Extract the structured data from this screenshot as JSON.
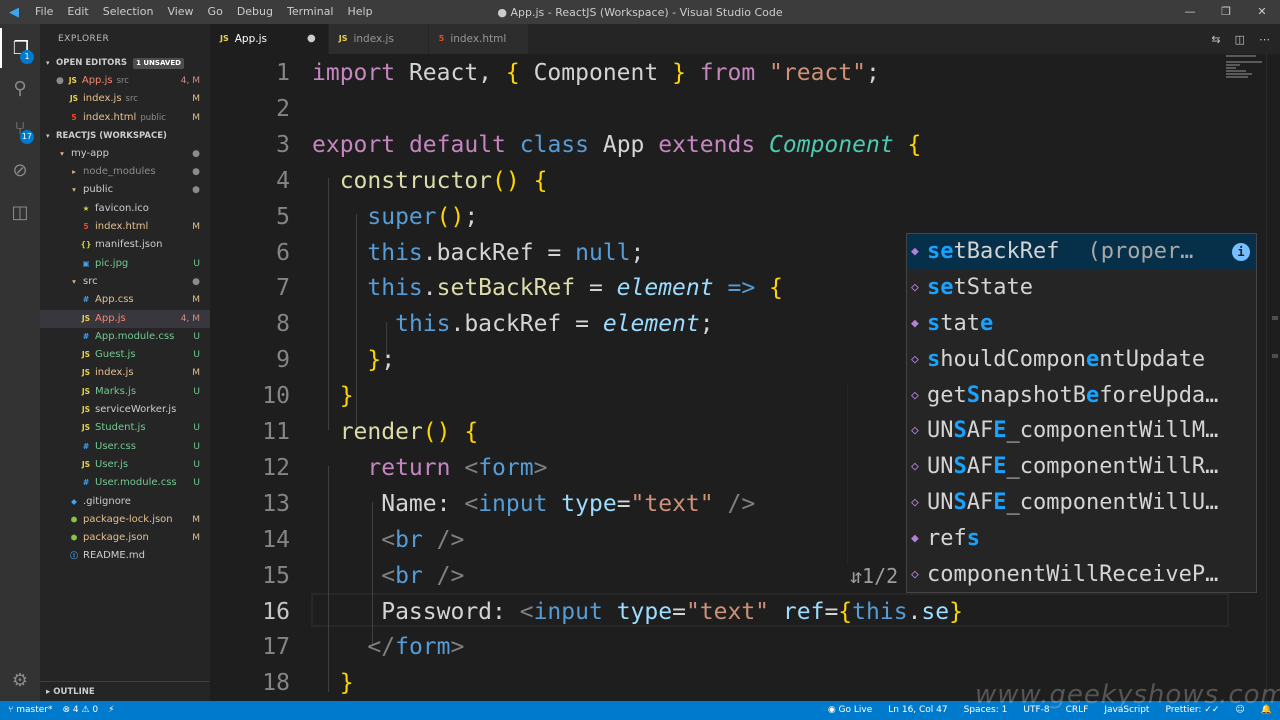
{
  "titlebar": {
    "menu": [
      "File",
      "Edit",
      "Selection",
      "View",
      "Go",
      "Debug",
      "Terminal",
      "Help"
    ],
    "title": "● App.js - ReactJS (Workspace) - Visual Studio Code",
    "minimize": "—",
    "maximize": "❐",
    "close": "✕"
  },
  "activity": {
    "scm_badge": "17",
    "explorer_badge": "1"
  },
  "sidebar": {
    "title": "EXPLORER",
    "open_editors_label": "OPEN EDITORS",
    "unsaved_label": "1 UNSAVED",
    "open_editors": [
      {
        "name": "App.js",
        "sub": "src",
        "status": "4, M",
        "icon": "JS"
      },
      {
        "name": "index.js",
        "sub": "src",
        "status": "M",
        "icon": "JS"
      },
      {
        "name": "index.html",
        "sub": "public",
        "status": "M",
        "icon": "5"
      }
    ],
    "workspace_label": "REACTJS (WORKSPACE)",
    "tree": [
      {
        "name": "my-app",
        "status": "●",
        "icon": "▾",
        "indent": 1
      },
      {
        "name": "node_modules",
        "status": "●",
        "icon": "▸",
        "indent": 2
      },
      {
        "name": "public",
        "status": "●",
        "icon": "▾",
        "indent": 2
      },
      {
        "name": "favicon.ico",
        "status": "",
        "icon": "★",
        "indent": 3
      },
      {
        "name": "index.html",
        "status": "M",
        "icon": "5",
        "indent": 3
      },
      {
        "name": "manifest.json",
        "status": "",
        "icon": "{}",
        "indent": 3
      },
      {
        "name": "pic.jpg",
        "status": "U",
        "icon": "▣",
        "indent": 3
      },
      {
        "name": "src",
        "status": "●",
        "icon": "▾",
        "indent": 2
      },
      {
        "name": "App.css",
        "status": "M",
        "icon": "#",
        "indent": 3
      },
      {
        "name": "App.js",
        "status": "4, M",
        "icon": "JS",
        "indent": 3
      },
      {
        "name": "App.module.css",
        "status": "U",
        "icon": "#",
        "indent": 3
      },
      {
        "name": "Guest.js",
        "status": "U",
        "icon": "JS",
        "indent": 3
      },
      {
        "name": "index.js",
        "status": "M",
        "icon": "JS",
        "indent": 3
      },
      {
        "name": "Marks.js",
        "status": "U",
        "icon": "JS",
        "indent": 3
      },
      {
        "name": "serviceWorker.js",
        "status": "",
        "icon": "JS",
        "indent": 3
      },
      {
        "name": "Student.js",
        "status": "U",
        "icon": "JS",
        "indent": 3
      },
      {
        "name": "User.css",
        "status": "U",
        "icon": "#",
        "indent": 3
      },
      {
        "name": "User.js",
        "status": "U",
        "icon": "JS",
        "indent": 3
      },
      {
        "name": "User.module.css",
        "status": "U",
        "icon": "#",
        "indent": 3
      },
      {
        "name": ".gitignore",
        "status": "",
        "icon": "◆",
        "indent": 2
      },
      {
        "name": "package-lock.json",
        "status": "M",
        "icon": "⬢",
        "indent": 2
      },
      {
        "name": "package.json",
        "status": "M",
        "icon": "⬢",
        "indent": 2
      },
      {
        "name": "README.md",
        "status": "",
        "icon": "ⓘ",
        "indent": 2
      }
    ],
    "outline_label": "OUTLINE"
  },
  "tabs": [
    {
      "label": "App.js",
      "icon": "JS",
      "close": "●",
      "active": true
    },
    {
      "label": "index.js",
      "icon": "JS",
      "close": "",
      "active": false
    },
    {
      "label": "index.html",
      "icon": "5",
      "close": "",
      "active": false
    }
  ],
  "editor": {
    "line_numbers": [
      "1",
      "2",
      "3",
      "4",
      "5",
      "6",
      "7",
      "8",
      "9",
      "10",
      "11",
      "12",
      "13",
      "14",
      "15",
      "16",
      "17",
      "18"
    ],
    "current_line": 16,
    "lines": [
      "import React, { Component } from \"react\";",
      "",
      "export default class App extends Component {",
      "  constructor() {",
      "    super();",
      "    this.backRef = null;",
      "    this.setBackRef = element => {",
      "      this.backRef = element;",
      "    };",
      "  }",
      "  render() {",
      "    return <form>",
      "     Name: <input type=\"text\" />",
      "     <br />",
      "     <br />",
      "     Password: <input type=\"text\" ref={this.se}",
      "    </form>",
      "  }"
    ]
  },
  "suggest": {
    "hint": "1/2",
    "items": [
      {
        "label": "setBackRef",
        "detail": "(proper…",
        "icon": "◆",
        "selected": true
      },
      {
        "label": "setState",
        "detail": "",
        "icon": "◇"
      },
      {
        "label": "state",
        "detail": "",
        "icon": "◆"
      },
      {
        "label": "shouldComponentUpdate",
        "detail": "",
        "icon": "◇"
      },
      {
        "label": "getSnapshotBeforeUpda…",
        "detail": "",
        "icon": "◇"
      },
      {
        "label": "UNSAFE_componentWillM…",
        "detail": "",
        "icon": "◇"
      },
      {
        "label": "UNSAFE_componentWillR…",
        "detail": "",
        "icon": "◇"
      },
      {
        "label": "UNSAFE_componentWillU…",
        "detail": "",
        "icon": "◇"
      },
      {
        "label": "refs",
        "detail": "",
        "icon": "◆"
      },
      {
        "label": "componentWillReceiveP…",
        "detail": "",
        "icon": "◇"
      }
    ]
  },
  "statusbar": {
    "branch": "master*",
    "problems": "⊗ 4 ⚠ 0",
    "sync": "⚡",
    "golive": "◉ Go Live",
    "position": "Ln 16, Col 47",
    "spaces": "Spaces: 1",
    "encoding": "UTF-8",
    "eol": "CRLF",
    "language": "JavaScript",
    "prettier": "Prettier: ✓✓"
  },
  "watermark": "www.geekyshows.com",
  "colors": {
    "accent": "#007acc",
    "editor_bg": "#1e1e1e",
    "sidebar_bg": "#252526",
    "keyword": "#c586c0",
    "string": "#ce9178",
    "tag": "#569cd6"
  }
}
